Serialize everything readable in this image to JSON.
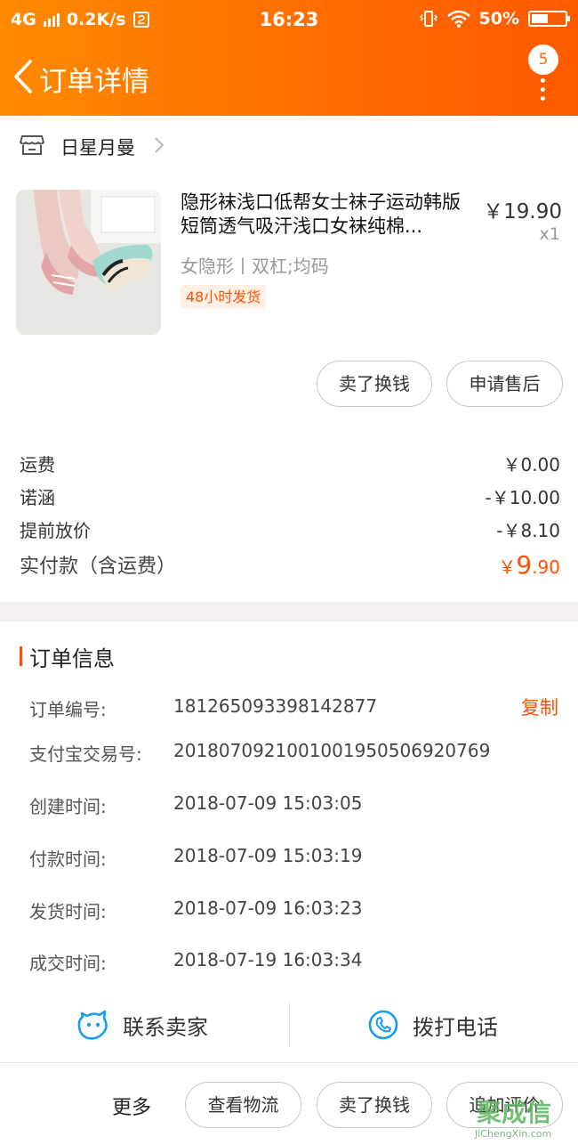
{
  "status_bar": {
    "network": "4G",
    "speed": "0.2K/s",
    "time": "16:23",
    "battery": "50%"
  },
  "nav": {
    "title": "订单详情",
    "badge_count": "5"
  },
  "shop": {
    "name": "日星月曼"
  },
  "item": {
    "title": "隐形袜浅口低帮女士袜子运动韩版短筒透气吸汗浅口女袜纯棉...",
    "price": "￥19.90",
    "quantity": "x1",
    "sku": "女隐形丨双杠;均码",
    "tag": "48小时发货"
  },
  "item_actions": {
    "sell_label": "卖了换钱",
    "aftersale_label": "申请售后"
  },
  "fees": [
    {
      "label": "运费",
      "value": "￥0.00"
    },
    {
      "label": "诺涵",
      "value": "-￥10.00"
    },
    {
      "label": "提前放价",
      "value": "-￥8.10"
    }
  ],
  "paid": {
    "label": "实付款（含运费）",
    "currency": "￥",
    "integer": "9",
    "decimal": ".90"
  },
  "order_info": {
    "heading": "订单信息",
    "copy_label": "复制",
    "rows": [
      {
        "label": "订单编号:",
        "value": "181265093398142877"
      },
      {
        "label": "支付宝交易号:",
        "value": "2018070921001001950506920769"
      },
      {
        "label": "创建时间:",
        "value": "2018-07-09 15:03:05"
      },
      {
        "label": "付款时间:",
        "value": "2018-07-09 15:03:19"
      },
      {
        "label": "发货时间:",
        "value": "2018-07-09 16:03:23"
      },
      {
        "label": "成交时间:",
        "value": "2018-07-19 16:03:34"
      }
    ]
  },
  "contact": {
    "seller_label": "联系卖家",
    "call_label": "拨打电话"
  },
  "bottom_bar": {
    "more_label": "更多",
    "logistics_label": "查看物流",
    "sell_label": "卖了换钱",
    "review_label": "追加评价"
  },
  "watermark": {
    "logo_text": "聚成信",
    "site": "JiChengXin.com"
  },
  "colors": {
    "brand_orange": "#ff6a00",
    "price_orange": "#ff5000"
  }
}
